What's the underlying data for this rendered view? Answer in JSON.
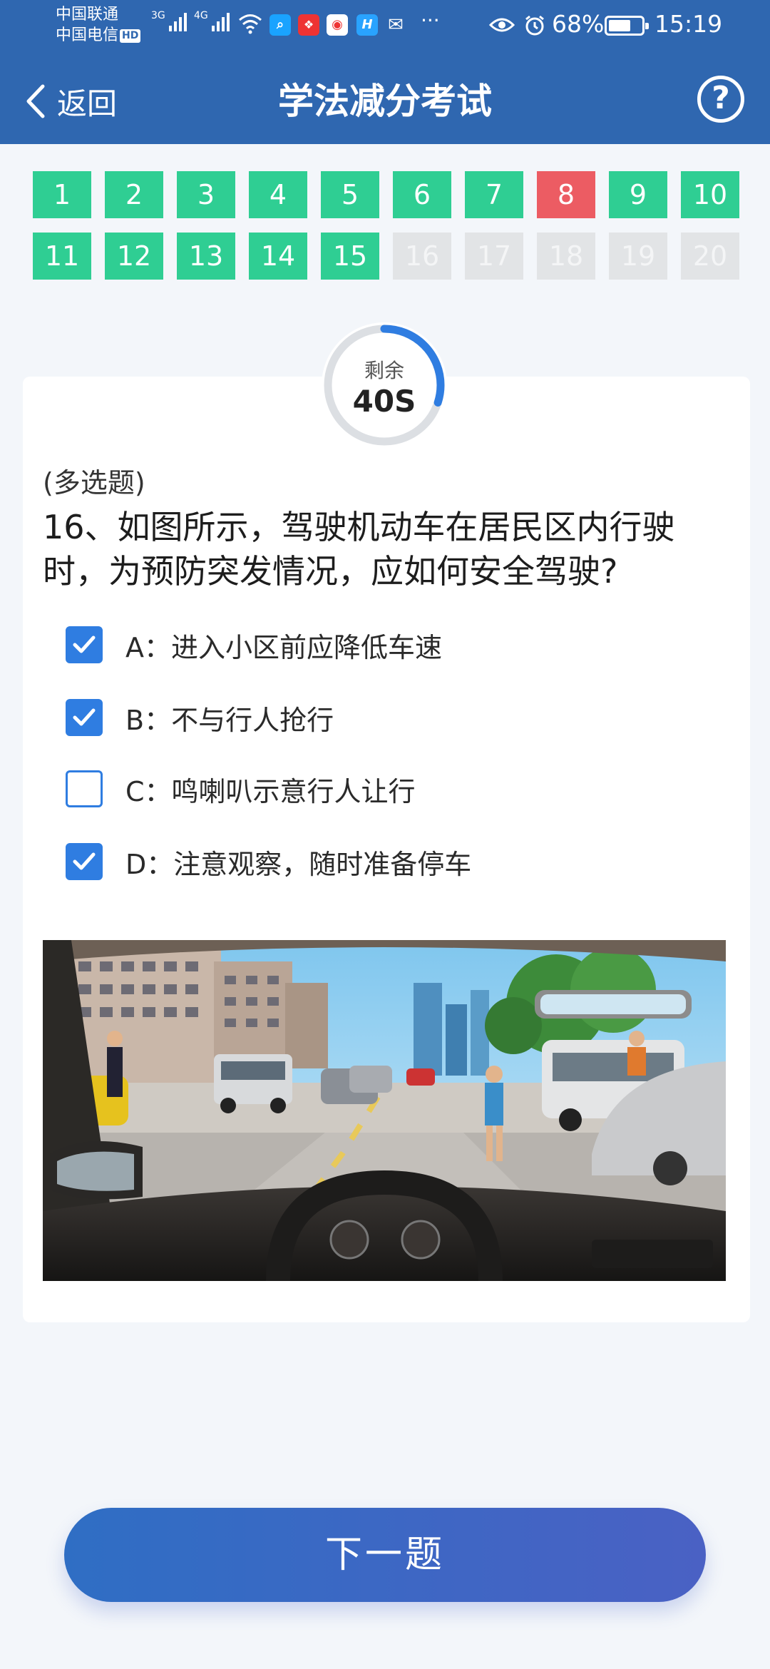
{
  "status_bar": {
    "carrier_1": "中国联通",
    "carrier_2": "中国电信",
    "hd_badge": "HD",
    "network_1": "3G",
    "network_2": "4G",
    "overflow": "···",
    "battery_percent": "68%",
    "battery_level": 0.68,
    "time": "15:19"
  },
  "app_bar": {
    "back_label": "返回",
    "title": "学法减分考试",
    "help_symbol": "?"
  },
  "question_grid": [
    {
      "number": "1",
      "state": "done"
    },
    {
      "number": "2",
      "state": "done"
    },
    {
      "number": "3",
      "state": "done"
    },
    {
      "number": "4",
      "state": "done"
    },
    {
      "number": "5",
      "state": "done"
    },
    {
      "number": "6",
      "state": "done"
    },
    {
      "number": "7",
      "state": "done"
    },
    {
      "number": "8",
      "state": "wrong"
    },
    {
      "number": "9",
      "state": "done"
    },
    {
      "number": "10",
      "state": "done"
    },
    {
      "number": "11",
      "state": "done"
    },
    {
      "number": "12",
      "state": "done"
    },
    {
      "number": "13",
      "state": "done"
    },
    {
      "number": "14",
      "state": "done"
    },
    {
      "number": "15",
      "state": "done"
    },
    {
      "number": "16",
      "state": "pending"
    },
    {
      "number": "17",
      "state": "pending"
    },
    {
      "number": "18",
      "state": "pending"
    },
    {
      "number": "19",
      "state": "pending"
    },
    {
      "number": "20",
      "state": "pending"
    }
  ],
  "timer": {
    "label": "剩余",
    "value": "40S",
    "remaining_fraction": 0.3
  },
  "question": {
    "type": "(多选题)",
    "text": "16、如图所示，驾驶机动车在居民区内行驶时，为预防突发情况，应如何安全驾驶?",
    "options": [
      {
        "text": "A：进入小区前应降低车速",
        "checked": true
      },
      {
        "text": "B：不与行人抢行",
        "checked": true
      },
      {
        "text": "C：鸣喇叭示意行人让行",
        "checked": false
      },
      {
        "text": "D：注意观察，随时准备停车",
        "checked": true
      }
    ]
  },
  "next_button": "下一题",
  "colors": {
    "header": "#2f67b0",
    "done": "#2fce93",
    "wrong": "#ec5c63",
    "pending": "#e2e4e6",
    "checkbox": "#2f7de1"
  }
}
